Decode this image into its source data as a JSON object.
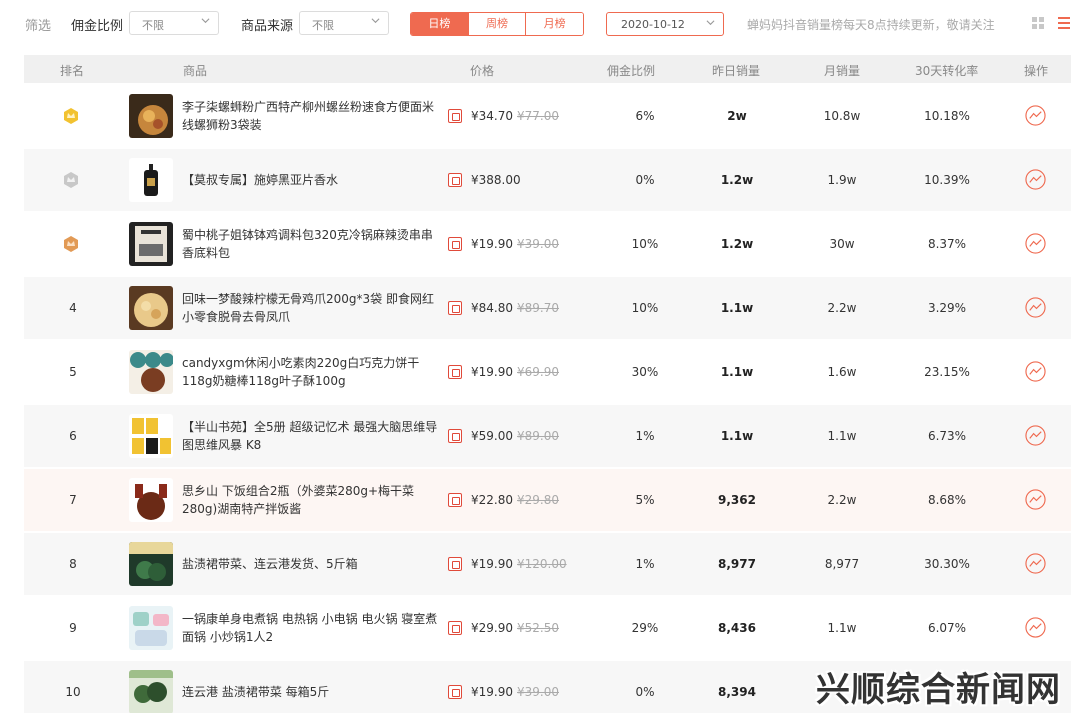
{
  "filter": {
    "label": "筛选",
    "commission_label": "佣金比例",
    "commission_value": "不限",
    "source_label": "商品来源",
    "source_value": "不限",
    "tabs": [
      "日榜",
      "周榜",
      "月榜"
    ],
    "active_tab": "日榜",
    "date": "2020-10-12",
    "notice": "蝉妈妈抖音销量榜每天8点持续更新，敬请关注"
  },
  "table": {
    "headers": {
      "rank": "排名",
      "product": "商品",
      "price": "价格",
      "commission": "佣金比例",
      "yesterday": "昨日销量",
      "monthly": "月销量",
      "conversion": "30天转化率",
      "action": "操作"
    },
    "rows": [
      {
        "rank": "1",
        "medal": "gold",
        "name": "李子柒螺蛳粉广西特产柳州螺丝粉速食方便面米线螺狮粉3袋装",
        "price": "¥34.70",
        "orig": "¥77.00",
        "commission": "6%",
        "yesterday": "2w",
        "monthly": "10.8w",
        "conversion": "10.18%"
      },
      {
        "rank": "2",
        "medal": "silver",
        "name": "【莫叔专属】施婷黑亚片香水",
        "price": "¥388.00",
        "orig": "",
        "commission": "0%",
        "yesterday": "1.2w",
        "monthly": "1.9w",
        "conversion": "10.39%"
      },
      {
        "rank": "3",
        "medal": "bronze",
        "name": "蜀中桃子姐钵钵鸡调料包320克冷锅麻辣烫串串香底料包",
        "price": "¥19.90",
        "orig": "¥39.00",
        "commission": "10%",
        "yesterday": "1.2w",
        "monthly": "30w",
        "conversion": "8.37%"
      },
      {
        "rank": "4",
        "medal": "",
        "name": "回味一梦酸辣柠檬无骨鸡爪200g*3袋 即食网红小零食脱骨去骨凤爪",
        "price": "¥84.80",
        "orig": "¥89.70",
        "commission": "10%",
        "yesterday": "1.1w",
        "monthly": "2.2w",
        "conversion": "3.29%"
      },
      {
        "rank": "5",
        "medal": "",
        "name": "candyxgm休闲小吃素肉220g白巧克力饼干118g奶糖棒118g叶子酥100g",
        "price": "¥19.90",
        "orig": "¥69.90",
        "commission": "30%",
        "yesterday": "1.1w",
        "monthly": "1.6w",
        "conversion": "23.15%"
      },
      {
        "rank": "6",
        "medal": "",
        "name": "【半山书苑】全5册 超级记忆术 最强大脑思维导图思维风暴 K8",
        "price": "¥59.00",
        "orig": "¥89.00",
        "commission": "1%",
        "yesterday": "1.1w",
        "monthly": "1.1w",
        "conversion": "6.73%"
      },
      {
        "rank": "7",
        "medal": "",
        "name": "思乡山 下饭组合2瓶（外婆菜280g+梅干菜280g)湖南特产拌饭酱",
        "price": "¥22.80",
        "orig": "¥29.80",
        "commission": "5%",
        "yesterday": "9,362",
        "monthly": "2.2w",
        "conversion": "8.68%"
      },
      {
        "rank": "8",
        "medal": "",
        "name": "盐渍裙带菜、连云港发货、5斤箱",
        "price": "¥19.90",
        "orig": "¥120.00",
        "commission": "1%",
        "yesterday": "8,977",
        "monthly": "8,977",
        "conversion": "30.30%"
      },
      {
        "rank": "9",
        "medal": "",
        "name": "一锅康单身电煮锅 电热锅 小电锅 电火锅 寝室煮面锅 小炒锅1人2",
        "price": "¥29.90",
        "orig": "¥52.50",
        "commission": "29%",
        "yesterday": "8,436",
        "monthly": "1.1w",
        "conversion": "6.07%"
      },
      {
        "rank": "10",
        "medal": "",
        "name": "连云港 盐渍裙带菜 每箱5斤",
        "price": "¥19.90",
        "orig": "¥39.00",
        "commission": "0%",
        "yesterday": "8,394",
        "monthly": "",
        "conversion": ""
      }
    ]
  },
  "watermark": "兴顺综合新闻网",
  "colors": {
    "accent": "#ef6a50",
    "header_bg": "#f0f0f0",
    "gold": "#f2c230",
    "silver": "#c8c8c8",
    "bronze": "#e29a55"
  }
}
